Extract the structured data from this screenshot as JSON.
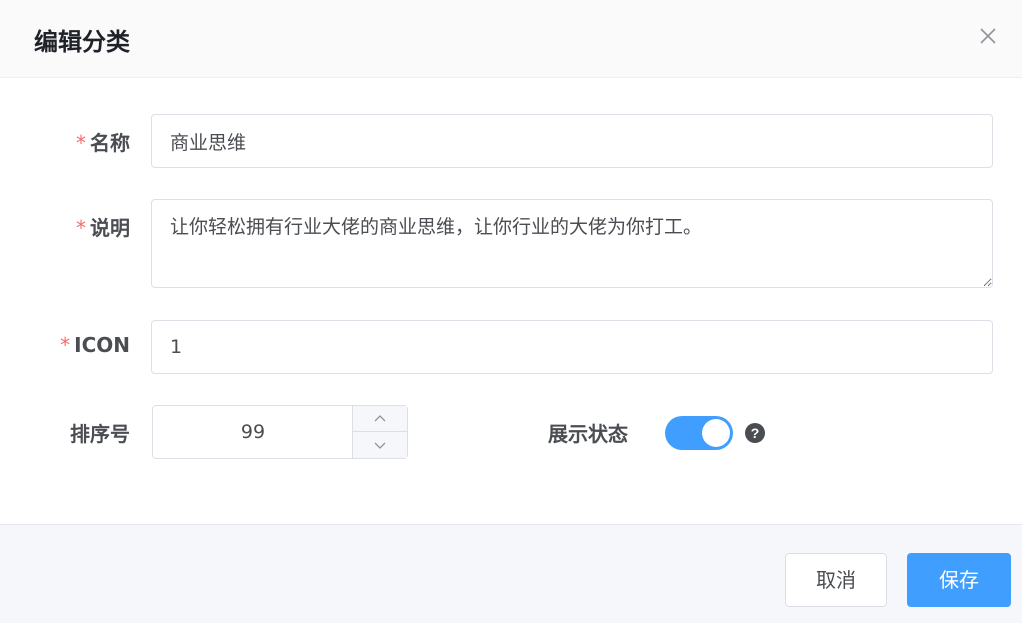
{
  "dialog": {
    "title": "编辑分类",
    "close_icon": "close-icon"
  },
  "form": {
    "name": {
      "required": "*",
      "label": "名称",
      "value": "商业思维"
    },
    "description": {
      "required": "*",
      "label": "说明",
      "value": "让你轻松拥有行业大佬的商业思维，让你行业的大佬为你打工。"
    },
    "icon": {
      "required": "*",
      "label": "ICON",
      "value": "1"
    },
    "sort": {
      "label": "排序号",
      "value": "99"
    },
    "display_status": {
      "label": "展示状态",
      "enabled": true,
      "help_glyph": "?"
    }
  },
  "footer": {
    "cancel_label": "取消",
    "save_label": "保存"
  },
  "colors": {
    "primary": "#409eff",
    "required": "#f56c6c",
    "footer_bg": "#f5f7fa",
    "header_bg": "#fafafa"
  }
}
